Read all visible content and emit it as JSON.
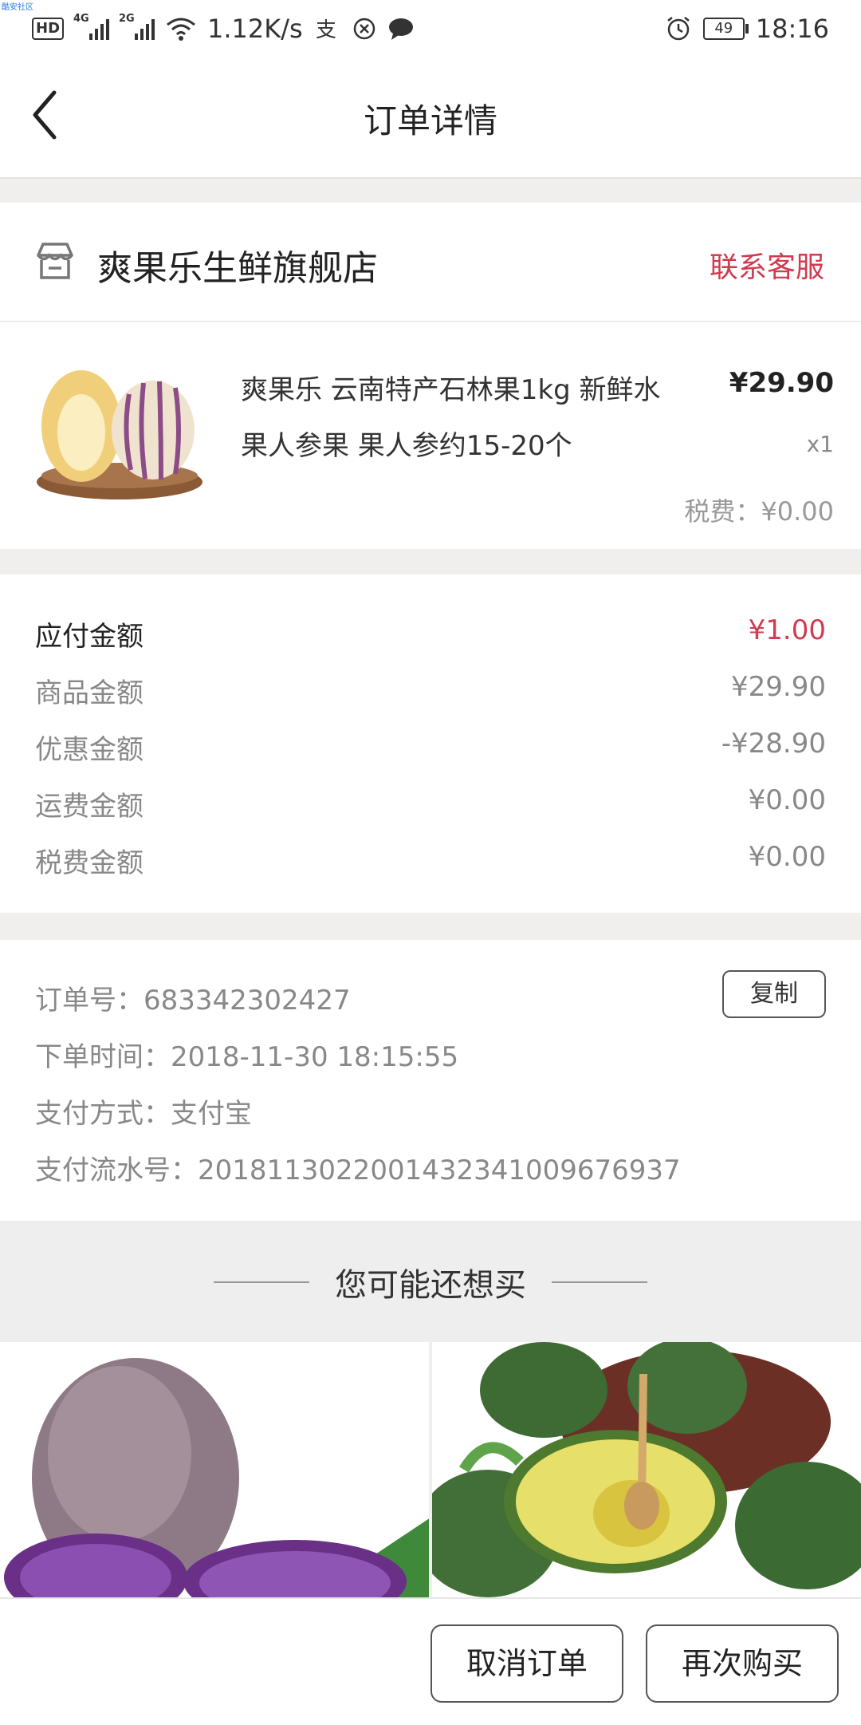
{
  "status_bar": {
    "network_speed": "1.12K/s",
    "signal_1": "4G",
    "signal_2": "2G",
    "hd": "HD",
    "battery": "49",
    "time": "18:16",
    "corner_tag": "酷安社区"
  },
  "header": {
    "title": "订单详情"
  },
  "shop": {
    "name": "爽果乐生鲜旗舰店",
    "contact_label": "联系客服"
  },
  "product": {
    "name": "爽果乐 云南特产石林果1kg 新鲜水果人参果 果人参约15-20个",
    "price": "¥29.90",
    "qty": "x1",
    "tax": "税费：¥0.00"
  },
  "amounts": [
    {
      "label": "应付金额",
      "value": "¥1.00"
    },
    {
      "label": "商品金额",
      "value": "¥29.90"
    },
    {
      "label": "优惠金额",
      "value": "-¥28.90"
    },
    {
      "label": "运费金额",
      "value": "¥0.00"
    },
    {
      "label": "税费金额",
      "value": "¥0.00"
    }
  ],
  "order_info": {
    "order_no": "订单号：683342302427",
    "order_time": "下单时间：2018-11-30 18:15:55",
    "pay_method": "支付方式：支付宝",
    "pay_serial": "支付流水号：2018113022001432341009676937",
    "copy_label": "复制"
  },
  "suggest": {
    "title": "您可能还想买"
  },
  "bottom_bar": {
    "cancel_label": "取消订单",
    "rebuy_label": "再次购买"
  },
  "colors": {
    "accent": "#d23a4e",
    "background": "#f1efee"
  }
}
